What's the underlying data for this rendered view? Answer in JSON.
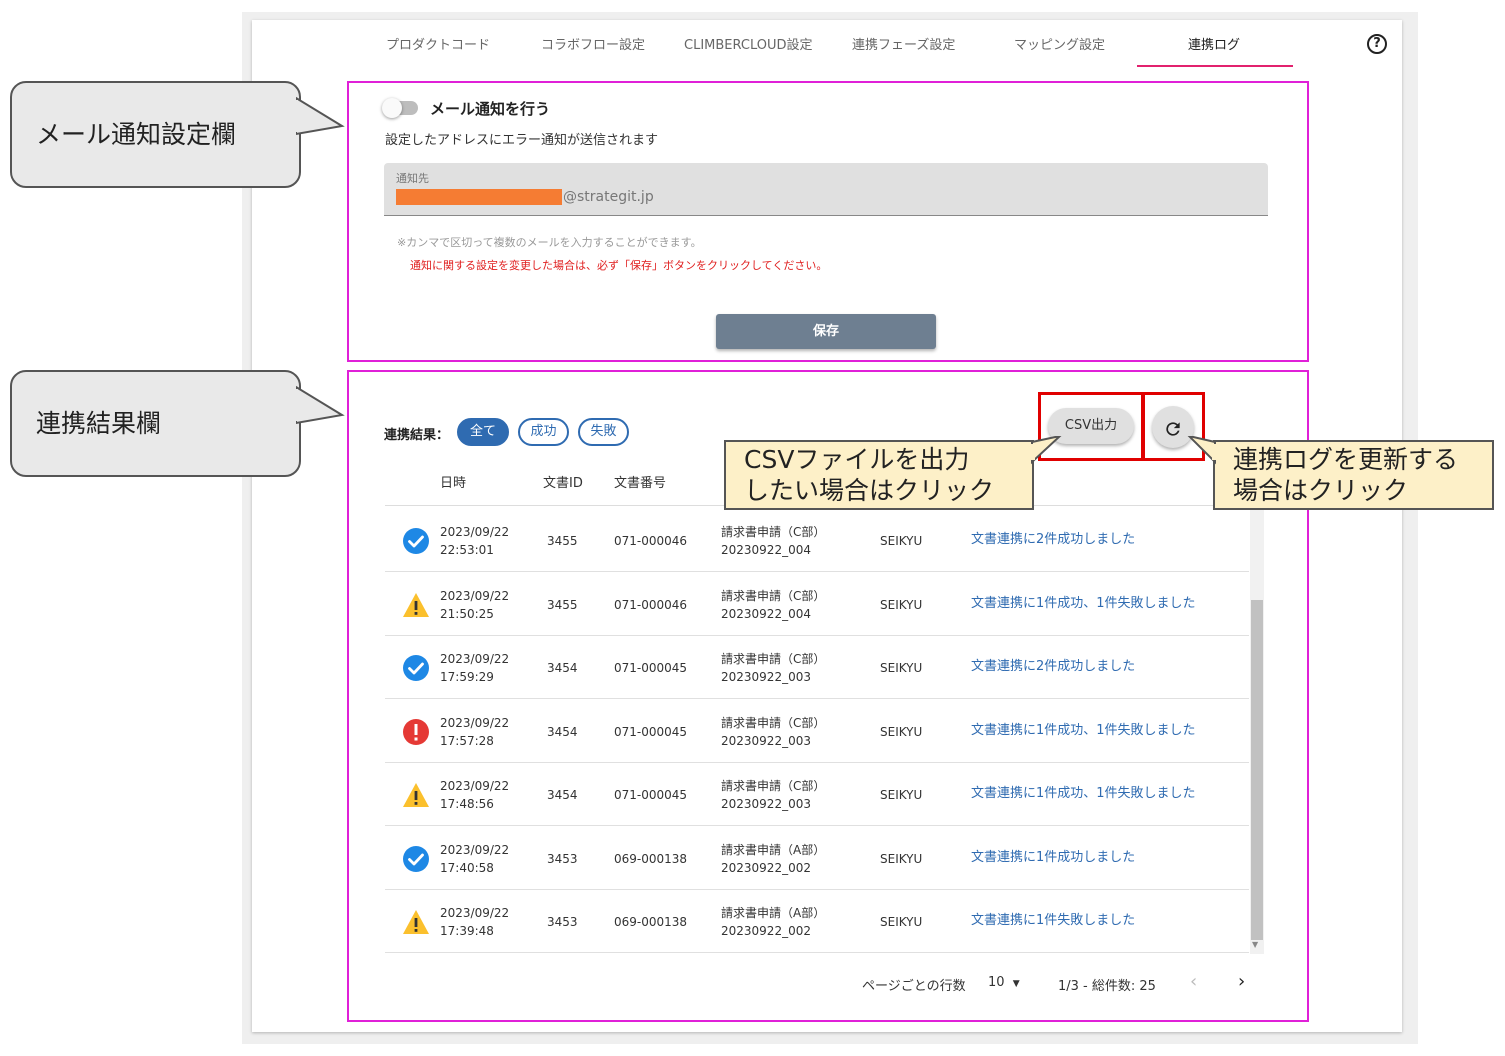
{
  "tabs": [
    {
      "label": "プロダクトコード"
    },
    {
      "label": "コラボフロー設定"
    },
    {
      "label": "CLIMBERCLOUD設定"
    },
    {
      "label": "連携フェーズ設定"
    },
    {
      "label": "マッピング設定"
    },
    {
      "label": "連携ログ"
    }
  ],
  "help_icon": "question-circle-icon",
  "callouts": {
    "mail": "メール通知設定欄",
    "result": "連携結果欄"
  },
  "mail": {
    "toggle_label": "メール通知を行う",
    "toggle_on": false,
    "description": "設定したアドレスにエラー通知が送信されます",
    "field_label": "通知先",
    "field_value_domain": "@strategit.jp",
    "hint": "※カンマで区切って複数のメールを入力することができます。",
    "warning": "通知に関する設定を変更した場合は、必ず「保存」ボタンをクリックしてください。",
    "save_label": "保存"
  },
  "results": {
    "label": "連携結果：",
    "filters": [
      {
        "label": "全て",
        "selected": true
      },
      {
        "label": "成功",
        "selected": false
      },
      {
        "label": "失敗",
        "selected": false
      }
    ],
    "csv_label": "CSV出力",
    "refresh_icon": "refresh-icon",
    "columns": [
      "日時",
      "文書ID",
      "文書番号"
    ],
    "rows": [
      {
        "status": "success",
        "date": "2023/09/22",
        "time": "22:53:01",
        "doc_id": "3455",
        "doc_no": "071-000046",
        "title1": "請求書申請（C部）",
        "title2": "20230922_004",
        "code": "SEIKYU",
        "message": "文書連携に2件成功しました"
      },
      {
        "status": "warning",
        "date": "2023/09/22",
        "time": "21:50:25",
        "doc_id": "3455",
        "doc_no": "071-000046",
        "title1": "請求書申請（C部）",
        "title2": "20230922_004",
        "code": "SEIKYU",
        "message": "文書連携に1件成功、1件失敗しました"
      },
      {
        "status": "success",
        "date": "2023/09/22",
        "time": "17:59:29",
        "doc_id": "3454",
        "doc_no": "071-000045",
        "title1": "請求書申請（C部）",
        "title2": "20230922_003",
        "code": "SEIKYU",
        "message": "文書連携に2件成功しました"
      },
      {
        "status": "error",
        "date": "2023/09/22",
        "time": "17:57:28",
        "doc_id": "3454",
        "doc_no": "071-000045",
        "title1": "請求書申請（C部）",
        "title2": "20230922_003",
        "code": "SEIKYU",
        "message": "文書連携に1件成功、1件失敗しました"
      },
      {
        "status": "warning",
        "date": "2023/09/22",
        "time": "17:48:56",
        "doc_id": "3454",
        "doc_no": "071-000045",
        "title1": "請求書申請（C部）",
        "title2": "20230922_003",
        "code": "SEIKYU",
        "message": "文書連携に1件成功、1件失敗しました"
      },
      {
        "status": "success",
        "date": "2023/09/22",
        "time": "17:40:58",
        "doc_id": "3453",
        "doc_no": "069-000138",
        "title1": "請求書申請（A部）",
        "title2": "20230922_002",
        "code": "SEIKYU",
        "message": "文書連携に1件成功しました"
      },
      {
        "status": "warning",
        "date": "2023/09/22",
        "time": "17:39:48",
        "doc_id": "3453",
        "doc_no": "069-000138",
        "title1": "請求書申請（A部）",
        "title2": "20230922_002",
        "code": "SEIKYU",
        "message": "文書連携に1件失敗しました"
      }
    ],
    "pager": {
      "rows_per_page_label": "ページごとの行数",
      "rows_per_page_value": "10",
      "range": "1/3 - 総件数: 25"
    }
  },
  "notes": {
    "csv": [
      "CSVファイルを出力",
      "したい場合はクリック"
    ],
    "refresh": [
      "連携ログを更新する",
      "場合はクリック"
    ]
  },
  "colors": {
    "accent": "#2f6bb1",
    "tab_underline": "#e2216e",
    "highlight_border": "#e020d8",
    "annotation_red": "#e00000",
    "success": "#1e88e5",
    "warning": "#fbc02d",
    "error": "#e53935"
  }
}
